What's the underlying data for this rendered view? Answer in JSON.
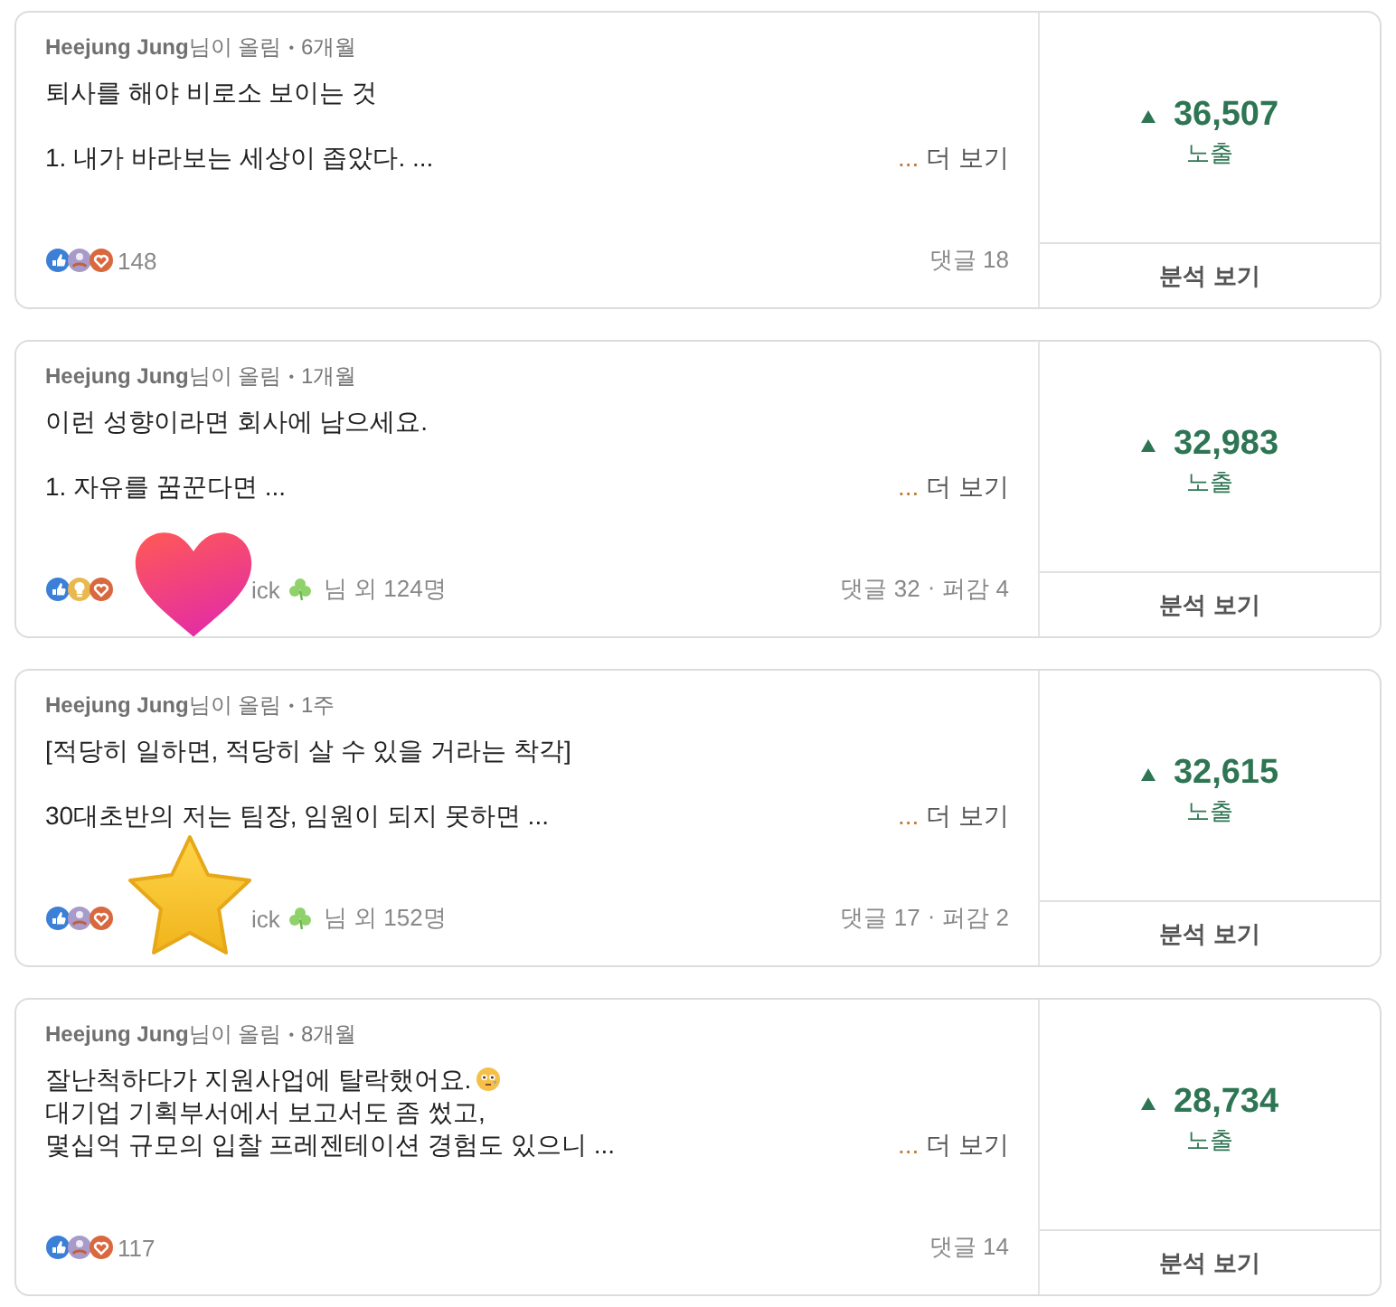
{
  "posts": [
    {
      "author": "Heejung Jung",
      "posted_label": "님이 올림",
      "bullet": "•",
      "age": "6개월",
      "paragraphs": [
        [
          {
            "text": "퇴사를 해야 비로소 보이는 것",
            "trailing_icon": false
          }
        ],
        [
          {
            "text": "1. 내가 바라보는 세상이 좁았다. ...",
            "trailing_icon": false
          }
        ]
      ],
      "more_ellipsis": "...",
      "more_link": "더 보기",
      "reactions": [
        {
          "kind": "like"
        },
        {
          "kind": "support"
        },
        {
          "kind": "love"
        }
      ],
      "reactors": {
        "count": "148"
      },
      "comments": "댓글 18",
      "impressions": {
        "rising": true,
        "value": "36,507",
        "label": "노출"
      },
      "analytics_button": "분석 보기"
    },
    {
      "author": "Heejung Jung",
      "posted_label": "님이 올림",
      "bullet": "•",
      "age": "1개월",
      "paragraphs": [
        [
          {
            "text": "이런 성향이라면 회사에 남으세요.",
            "trailing_icon": false
          }
        ],
        [
          {
            "text": "1. 자유를 꿈꾼다면 ...",
            "trailing_icon": false
          }
        ]
      ],
      "more_ellipsis": "...",
      "more_link": "더 보기",
      "reactions": [
        {
          "kind": "like"
        },
        {
          "kind": "insightful"
        },
        {
          "kind": "love"
        }
      ],
      "reactors": {
        "fragment": "ick",
        "clover": true,
        "count": "님 외 124명"
      },
      "sticker": {
        "kind": "heart"
      },
      "comments": "댓글 32",
      "share_separator": "·",
      "shares": "퍼감 4",
      "impressions": {
        "rising": true,
        "value": "32,983",
        "label": "노출"
      },
      "analytics_button": "분석 보기"
    },
    {
      "author": "Heejung Jung",
      "posted_label": "님이 올림",
      "bullet": "•",
      "age": "1주",
      "paragraphs": [
        [
          {
            "text": "[적당히 일하면, 적당히 살 수 있을 거라는 착각]",
            "trailing_icon": false
          }
        ],
        [
          {
            "text": "30대초반의 저는 팀장, 임원이 되지 못하면 ...",
            "trailing_icon": false
          }
        ]
      ],
      "more_ellipsis": "...",
      "more_link": "더 보기",
      "reactions": [
        {
          "kind": "like"
        },
        {
          "kind": "support"
        },
        {
          "kind": "love"
        }
      ],
      "reactors": {
        "fragment": "ick",
        "clover": true,
        "count": "님 외 152명"
      },
      "sticker": {
        "kind": "star"
      },
      "comments": "댓글 17",
      "share_separator": "·",
      "shares": "퍼감 2",
      "impressions": {
        "rising": true,
        "value": "32,615",
        "label": "노출"
      },
      "analytics_button": "분석 보기"
    },
    {
      "author": "Heejung Jung",
      "posted_label": "님이 올림",
      "bullet": "•",
      "age": "8개월",
      "paragraphs": [
        [
          {
            "text": "잘난척하다가 지원사업에 탈락했어요.",
            "trailing_icon": true
          },
          {
            "text": "대기업 기획부서에서 보고서도 좀 썼고,",
            "trailing_icon": false
          },
          {
            "text": "몇십억 규모의 입찰 프레젠테이션 경험도 있으니 ...",
            "trailing_icon": false
          }
        ]
      ],
      "more_ellipsis": "...",
      "more_link": "더 보기",
      "reactions": [
        {
          "kind": "like"
        },
        {
          "kind": "support"
        },
        {
          "kind": "love"
        }
      ],
      "reactors": {
        "count": "117"
      },
      "comments": "댓글 14",
      "impressions": {
        "rising": true,
        "value": "28,734",
        "label": "노출"
      },
      "analytics_button": "분석 보기"
    }
  ]
}
